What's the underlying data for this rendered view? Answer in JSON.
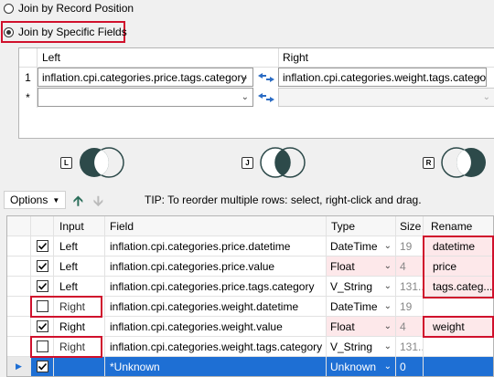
{
  "join_options": {
    "record_position": "Join by Record Position",
    "specific_fields": "Join by Specific Fields",
    "selected": "specific_fields"
  },
  "join_table": {
    "left_header": "Left",
    "right_header": "Right",
    "rows": [
      {
        "num": "1",
        "left": "inflation.cpi.categories.price.tags.category",
        "right": "inflation.cpi.categories.weight.tags.category"
      },
      {
        "num": "*",
        "left": "",
        "right": ""
      }
    ]
  },
  "venn": {
    "left_badge": "L",
    "join_badge": "J",
    "right_badge": "R"
  },
  "toolbar": {
    "options_label": "Options",
    "tip": "TIP: To reorder multiple rows: select, right-click and drag."
  },
  "grid": {
    "headers": {
      "input": "Input",
      "field": "Field",
      "type": "Type",
      "size": "Size",
      "rename": "Rename"
    },
    "rows": [
      {
        "checked": true,
        "input": "Left",
        "field": "inflation.cpi.categories.price.datetime",
        "type": "DateTime",
        "size": "19",
        "rename": "datetime"
      },
      {
        "checked": true,
        "input": "Left",
        "field": "inflation.cpi.categories.price.value",
        "type": "Float",
        "size": "4",
        "rename": "price"
      },
      {
        "checked": true,
        "input": "Left",
        "field": "inflation.cpi.categories.price.tags.category",
        "type": "V_String",
        "size": "131...",
        "rename": "tags.categ..."
      },
      {
        "checked": false,
        "input": "Right",
        "field": "inflation.cpi.categories.weight.datetime",
        "type": "DateTime",
        "size": "19",
        "rename": ""
      },
      {
        "checked": true,
        "input": "Right",
        "field": "inflation.cpi.categories.weight.value",
        "type": "Float",
        "size": "4",
        "rename": "weight"
      },
      {
        "checked": false,
        "input": "Right",
        "field": "inflation.cpi.categories.weight.tags.category",
        "type": "V_String",
        "size": "131...",
        "rename": ""
      },
      {
        "checked": true,
        "input": "",
        "field": "*Unknown",
        "type": "Unknown",
        "size": "0",
        "rename": ""
      }
    ]
  },
  "colors": {
    "highlight_red": "#d0102c",
    "selection_blue": "#1e6fd4",
    "venn_dark": "#2d4a4a"
  }
}
